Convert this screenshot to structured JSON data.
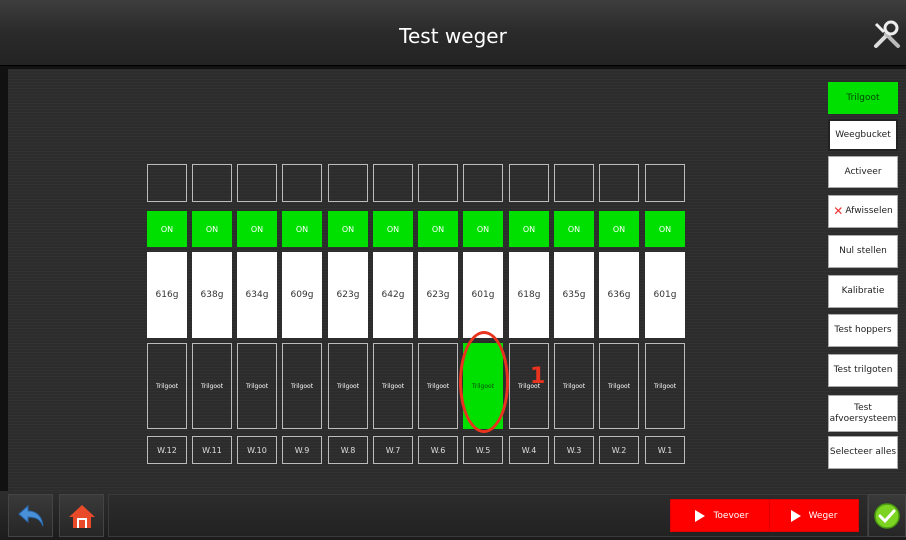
{
  "header": {
    "title": "Test weger"
  },
  "controls": {
    "trilgoot": "Trilgoot",
    "weegbucket": "Weegbucket",
    "activeer": "Activeer",
    "afwisselen": "Afwisselen",
    "nul_stellen": "Nul stellen",
    "kalibratie": "Kalibratie",
    "test_hoppers": "Test hoppers",
    "test_trilgoten": "Test trilgoten",
    "test_afvoer_line1": "Test",
    "test_afvoer_line2": "afvoersysteem",
    "selecteer_alles": "Selecteer alles"
  },
  "weighers": [
    {
      "label": "W.12",
      "status": "ON",
      "weight": "616g",
      "feeder": "Trilgoot",
      "feeder_active": false
    },
    {
      "label": "W.11",
      "status": "ON",
      "weight": "638g",
      "feeder": "Trilgoot",
      "feeder_active": false
    },
    {
      "label": "W.10",
      "status": "ON",
      "weight": "634g",
      "feeder": "Trilgoot",
      "feeder_active": false
    },
    {
      "label": "W.9",
      "status": "ON",
      "weight": "609g",
      "feeder": "Trilgoot",
      "feeder_active": false
    },
    {
      "label": "W.8",
      "status": "ON",
      "weight": "623g",
      "feeder": "Trilgoot",
      "feeder_active": false
    },
    {
      "label": "W.7",
      "status": "ON",
      "weight": "642g",
      "feeder": "Trilgoot",
      "feeder_active": false
    },
    {
      "label": "W.6",
      "status": "ON",
      "weight": "623g",
      "feeder": "Trilgoot",
      "feeder_active": false
    },
    {
      "label": "W.5",
      "status": "ON",
      "weight": "601g",
      "feeder": "Trilgoot",
      "feeder_active": true
    },
    {
      "label": "W.4",
      "status": "ON",
      "weight": "618g",
      "feeder": "Trilgoot",
      "feeder_active": false
    },
    {
      "label": "W.3",
      "status": "ON",
      "weight": "635g",
      "feeder": "Trilgoot",
      "feeder_active": false
    },
    {
      "label": "W.2",
      "status": "ON",
      "weight": "636g",
      "feeder": "Trilgoot",
      "feeder_active": false
    },
    {
      "label": "W.1",
      "status": "ON",
      "weight": "601g",
      "feeder": "Trilgoot",
      "feeder_active": false
    }
  ],
  "annotation": {
    "number": "1"
  },
  "footer": {
    "toevoer": "Toevoer",
    "weger": "Weger"
  },
  "icons": {
    "settings": "wrench-icon",
    "back": "back-arrow-icon",
    "home": "home-icon",
    "confirm": "checkmark-icon"
  },
  "colors": {
    "active_green": "#00e000",
    "action_red": "#ff0000",
    "annotation_red": "#e8331f"
  }
}
